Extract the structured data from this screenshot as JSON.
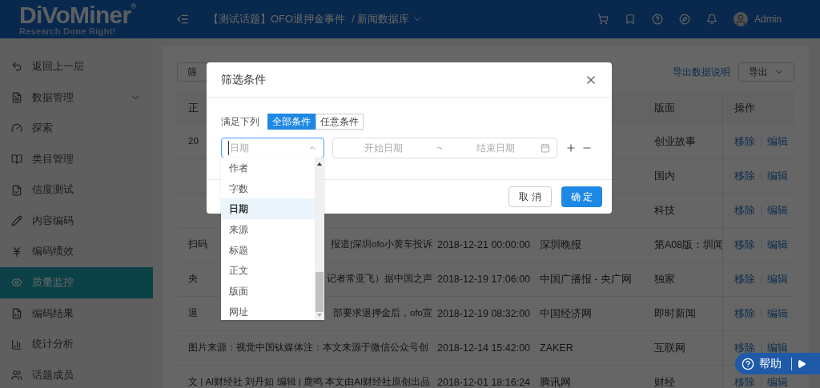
{
  "header": {
    "logo": "DiVoMiner",
    "logo_mark": "®",
    "tagline": "Research Done Right!",
    "breadcrumb": "【测试话题】OFO退押金事件",
    "breadcrumb_sub": "/ 新闻数据库",
    "user": "Admin"
  },
  "sidebar": {
    "items": [
      {
        "label": "返回上一层",
        "selected": false,
        "expandable": false
      },
      {
        "label": "数据管理",
        "selected": false,
        "expandable": true
      },
      {
        "label": "探索",
        "selected": false,
        "expandable": false
      },
      {
        "label": "类目管理",
        "selected": false,
        "expandable": false
      },
      {
        "label": "信度测试",
        "selected": false,
        "expandable": false
      },
      {
        "label": "内容编码",
        "selected": false,
        "expandable": false
      },
      {
        "label": "编码绩效",
        "selected": false,
        "expandable": false
      },
      {
        "label": "质量监控",
        "selected": true,
        "expandable": false
      },
      {
        "label": "编码结果",
        "selected": false,
        "expandable": false
      },
      {
        "label": "统计分析",
        "selected": false,
        "expandable": false
      },
      {
        "label": "话题成员",
        "selected": false,
        "expandable": false
      }
    ]
  },
  "toolbar": {
    "filter_button": "筛",
    "export_help": "导出数据说明",
    "export_button": "导出"
  },
  "table": {
    "columns": [
      "正",
      "版面",
      "操作"
    ],
    "rows": [
      {
        "body": [
          "20"
        ],
        "section": "创业故事",
        "actions": [
          "移除",
          "编辑"
        ]
      },
      {
        "body": [],
        "section": "国内",
        "actions": [
          "移除",
          "编辑"
        ]
      },
      {
        "body": [],
        "section": "科技",
        "actions": [
          "移除",
          "编辑"
        ]
      },
      {
        "body": [
          "扫码",
          "报道|深圳ofo小黄车投诉"
        ],
        "date": "2018-12-21 00:00:00",
        "source": "深圳晚报",
        "section": "第A08版：圳闻",
        "actions": [
          "移除",
          "编辑"
        ]
      },
      {
        "body": [
          "央",
          "记者常亚飞）据中国之声"
        ],
        "date": "2018-12-19 17:06:00",
        "source": "中国广播报 - 央广网",
        "section": "独家",
        "actions": [
          "移除",
          "编辑"
        ]
      },
      {
        "body": [
          "退",
          "部要求退押金后，ofo宣"
        ],
        "date": "2018-12-19 08:32:00",
        "source": "中国经济网",
        "section": "即时新闻",
        "actions": [
          "移除",
          "编辑"
        ]
      },
      {
        "body": [
          "图片来源：视觉中国钛媒体注：本文来源于微信公众号创"
        ],
        "date": "2018-12-14 15:42:00",
        "source": "ZAKER",
        "section": "互联网",
        "actions": [
          "移除",
          "编辑"
        ]
      },
      {
        "body": [
          "文 | AI财经社 刘丹如 编辑 | 鹿鸣 本文由AI财经社原创出品"
        ],
        "date": "2018-12-01 18:16:24",
        "source": "腾讯网",
        "section": "财经",
        "actions": [
          "移除",
          "编辑"
        ]
      }
    ]
  },
  "dialog": {
    "title": "筛选条件",
    "match_label": "满足下列",
    "match_options": [
      {
        "label": "全部条件",
        "selected": true
      },
      {
        "label": "任意条件",
        "selected": false
      }
    ],
    "field_select": {
      "placeholder": "日期",
      "expanded": true
    },
    "date_range": {
      "start_placeholder": "开始日期",
      "separator": "~",
      "end_placeholder": "结束日期"
    },
    "cancel": "取 消",
    "confirm": "确 定"
  },
  "field_options": [
    {
      "label": "作者",
      "selected": false
    },
    {
      "label": "字数",
      "selected": false
    },
    {
      "label": "日期",
      "selected": true
    },
    {
      "label": "来源",
      "selected": false
    },
    {
      "label": "标题",
      "selected": false
    },
    {
      "label": "正文",
      "selected": false
    },
    {
      "label": "版面",
      "selected": false
    },
    {
      "label": "网址",
      "selected": false
    }
  ],
  "help_button": "帮助"
}
